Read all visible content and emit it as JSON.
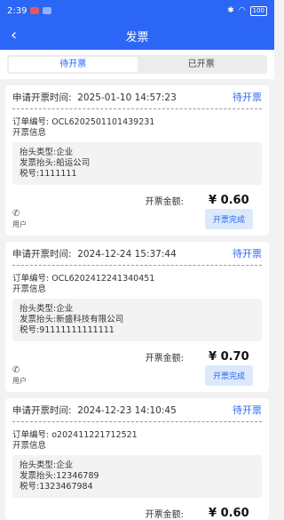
{
  "status_bar": {
    "time": "2:39",
    "battery": "100"
  },
  "header": {
    "back_icon": "chevron-left-icon",
    "title": "发票"
  },
  "tabs": [
    {
      "label": "待开票",
      "active": true
    },
    {
      "label": "已开票",
      "active": false
    }
  ],
  "labels": {
    "apply_time": "申请开票时间:",
    "order_no": "订单编号:",
    "invoice_info": "开票信息",
    "head_type": "抬头类型:",
    "invoice_head": "发票抬头:",
    "tax_no": "税号:",
    "amount": "开票金额:",
    "user": "用户",
    "done_button": "开票完成"
  },
  "invoices": [
    {
      "time": "2025-01-10 14:57:23",
      "status": "待开票",
      "order_no": "OCL6202501101439231",
      "head_type": "企业",
      "head": "船运公司",
      "tax_no": "1111111",
      "amount": "¥ 0.60"
    },
    {
      "time": "2024-12-24 15:37:44",
      "status": "待开票",
      "order_no": "OCL6202412241340451",
      "head_type": "企业",
      "head": "新盛科技有限公司",
      "tax_no": "91111111111111",
      "amount": "¥ 0.70"
    },
    {
      "time": "2024-12-23 14:10:45",
      "status": "待开票",
      "order_no": "o202411221712521",
      "head_type": "企业",
      "head": "12346789",
      "tax_no": "1323467984",
      "amount": "¥ 0.60"
    }
  ]
}
